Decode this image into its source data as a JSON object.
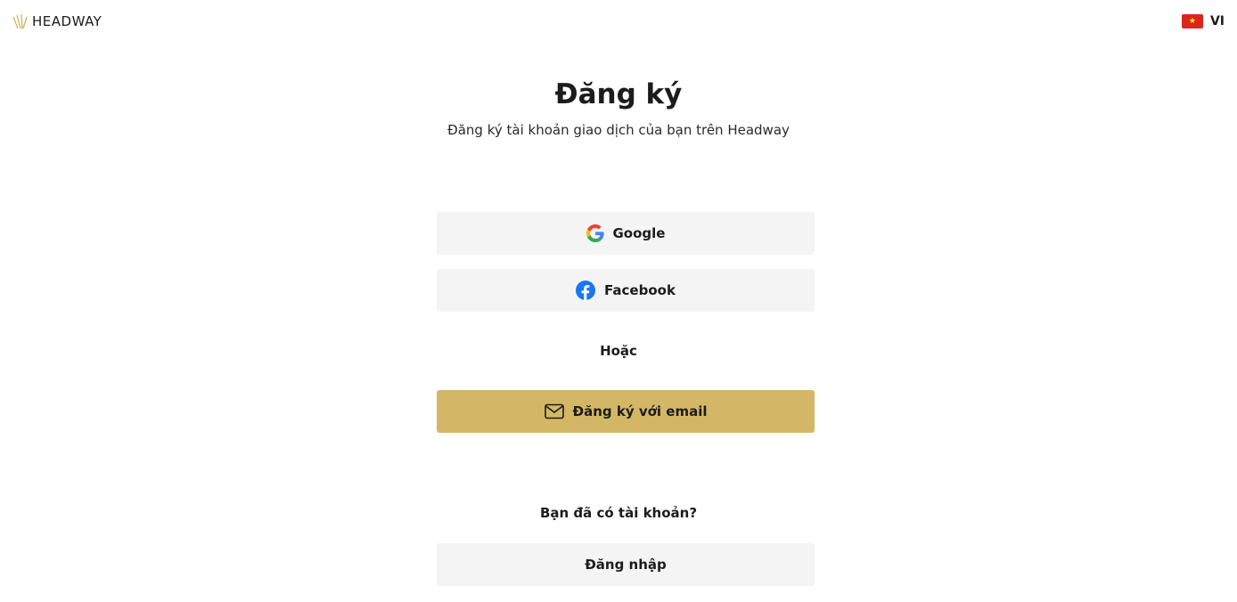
{
  "header": {
    "logo_text": "HEADWAY",
    "language_code": "VI"
  },
  "main": {
    "title": "Đăng ký",
    "subtitle": "Đăng ký tài khoản giao dịch của bạn trên Headway",
    "google_label": "Google",
    "facebook_label": "Facebook",
    "or_label": "Hoặc",
    "email_label": "Đăng ký với email",
    "have_account_label": "Bạn đã có tài khoản?",
    "login_label": "Đăng nhập"
  },
  "colors": {
    "accent": "#d4b766",
    "button_bg": "#f4f4f4",
    "facebook_blue": "#1877f2",
    "flag_red": "#da251d"
  },
  "icons": {
    "logo": "headway-logo-mark",
    "flag": "vietnam-flag-icon",
    "google": "google-icon",
    "facebook": "facebook-icon",
    "email": "envelope-icon"
  }
}
